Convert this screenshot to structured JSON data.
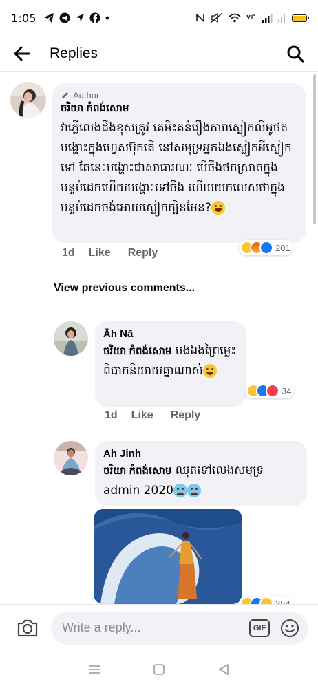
{
  "status_bar": {
    "time": "1:05"
  },
  "header": {
    "title": "Replies"
  },
  "top_comment": {
    "author_tag": "Author",
    "name": "ចរិយា កំពង់សោម",
    "text": "វាភ្លើលេងដឹងខុសត្រូវ គេអិះគន់រឿងតារាស្លៀកលីអូថតបង្ហោះក្នុងហ្វេសប៊ុកតើ នៅសមុទ្រអ្នកឯងស្លៀកអីស្លៀកទៅ តែនេះបង្ហោះជាសាធារណៈ បើចឹងថតស្រាតក្នុងបន្ទប់ដេកហើយបង្ហោះទៅចឹង ហើយយកលេសថាក្នុងបន្ទប់ដេកចង់អោយស្លៀកក្បិនមែន?",
    "time": "1d",
    "like_label": "Like",
    "reply_label": "Reply",
    "reaction_count": "201"
  },
  "view_previous": "View previous comments...",
  "replies": [
    {
      "name": "Āh Nā",
      "mention": "ចរិយា កំពង់សោម",
      "text": "បងឯងព្រៃម្លេះ ពិបាកនិយាយគ្នាណាស់",
      "time": "1d",
      "like_label": "Like",
      "reply_label": "Reply",
      "reaction_count": "34"
    },
    {
      "name": "Ah Jinh",
      "mention": "ចរិយា កំពង់សោម",
      "text": "ឈុតទៅលេងសមុទ្រ admin 2020",
      "reaction_count": "254"
    }
  ],
  "composer": {
    "placeholder": "Write a reply...",
    "gif_label": "GIF"
  },
  "colors": {
    "accent": "#1877f2",
    "bubble": "#f0f2f5",
    "meta": "#65676b"
  }
}
